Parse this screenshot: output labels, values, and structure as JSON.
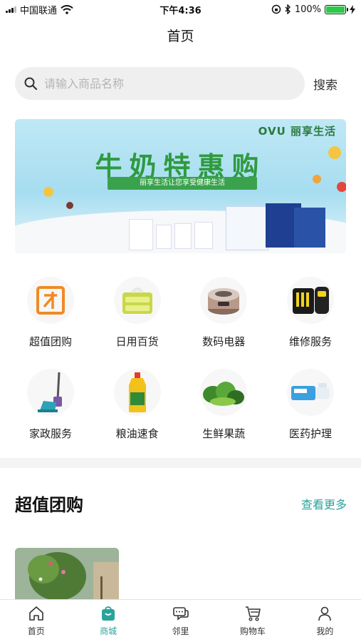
{
  "status_bar": {
    "carrier": "中国联通",
    "time": "下午4:36",
    "battery": "100%",
    "battery_level": 1.0
  },
  "nav": {
    "title": "首页"
  },
  "search": {
    "placeholder": "请输入商品名称",
    "value": "",
    "button_label": "搜索"
  },
  "banner": {
    "brand": "OVU 丽享生活",
    "title": "牛奶特惠购",
    "subtitle": "丽享生活让您享受健康生活"
  },
  "categories": [
    {
      "label": "超值团购",
      "icon": "group-buy-icon"
    },
    {
      "label": "日用百货",
      "icon": "daily-goods-icon"
    },
    {
      "label": "数码电器",
      "icon": "rice-cooker-icon"
    },
    {
      "label": "维修服务",
      "icon": "repair-tools-icon"
    },
    {
      "label": "家政服务",
      "icon": "mop-icon"
    },
    {
      "label": "粮油速食",
      "icon": "cooking-oil-icon"
    },
    {
      "label": "生鲜果蔬",
      "icon": "vegetables-icon"
    },
    {
      "label": "医药护理",
      "icon": "medicine-icon"
    }
  ],
  "section": {
    "title": "超值团购",
    "more_label": "查看更多"
  },
  "tabbar": {
    "active": 1,
    "items": [
      {
        "label": "首页",
        "icon": "home-icon"
      },
      {
        "label": "商城",
        "icon": "shopping-bag-icon"
      },
      {
        "label": "邻里",
        "icon": "chat-icon"
      },
      {
        "label": "购物车",
        "icon": "cart-icon"
      },
      {
        "label": "我的",
        "icon": "user-icon"
      }
    ]
  },
  "colors": {
    "accent": "#2aa39a",
    "orange": "#f08a24",
    "banner_green": "#2f9a3f"
  }
}
